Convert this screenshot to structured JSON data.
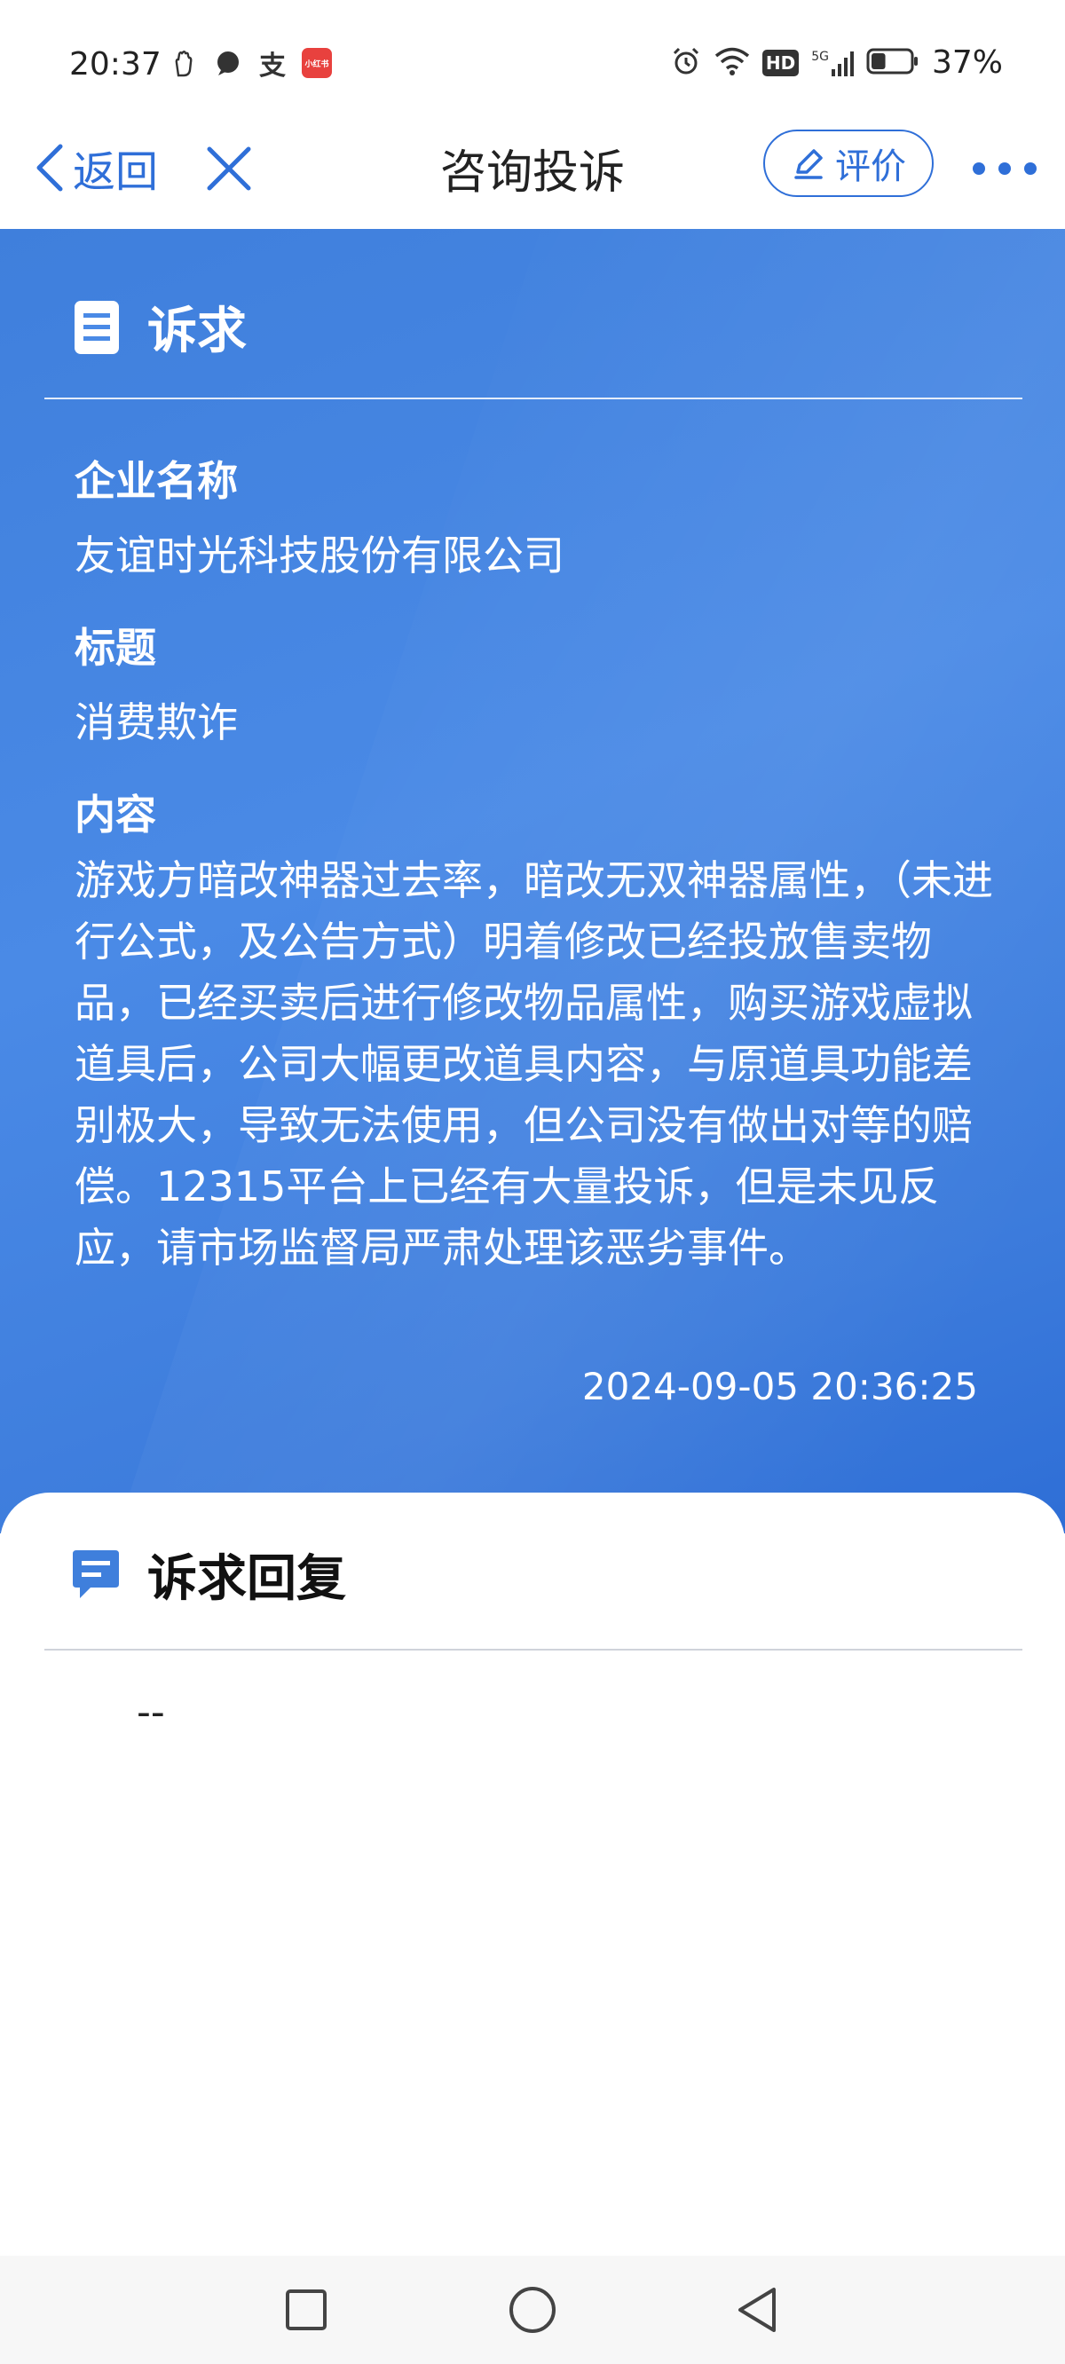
{
  "status_bar": {
    "time": "20:37",
    "left_icons": [
      "hand-icon",
      "chat-icon",
      "alipay-icon",
      "xiaohongshu-icon"
    ],
    "xiaohongshu_label": "小红书",
    "alipay_label": "支",
    "hd_label": "HD",
    "network_label": "5G",
    "battery_percent": "37%",
    "battery_level": 0.37
  },
  "nav": {
    "back_label": "返回",
    "title": "咨询投诉",
    "rate_label": "评价"
  },
  "complaint": {
    "section_title": "诉求",
    "company_label": "企业名称",
    "company_value": "友谊时光科技股份有限公司",
    "title_label": "标题",
    "title_value": "消费欺诈",
    "content_label": "内容",
    "content_value": "游戏方暗改神器过去率，暗改无双神器属性，（未进行公式，及公告方式）明着修改已经投放售卖物品，已经买卖后进行修改物品属性，购买游戏虚拟道具后，公司大幅更改道具内容，与原道具功能差别极大，导致无法使用，但公司没有做出对等的赔偿。12315平台上已经有大量投诉，但是未见反应，请市场监督局严肃处理该恶劣事件。",
    "timestamp": "2024-09-05 20:36:25"
  },
  "reply": {
    "section_title": "诉求回复",
    "value": "--"
  },
  "colors": {
    "accent": "#2f6fd8",
    "blue_bg": "#4a8ae6"
  }
}
